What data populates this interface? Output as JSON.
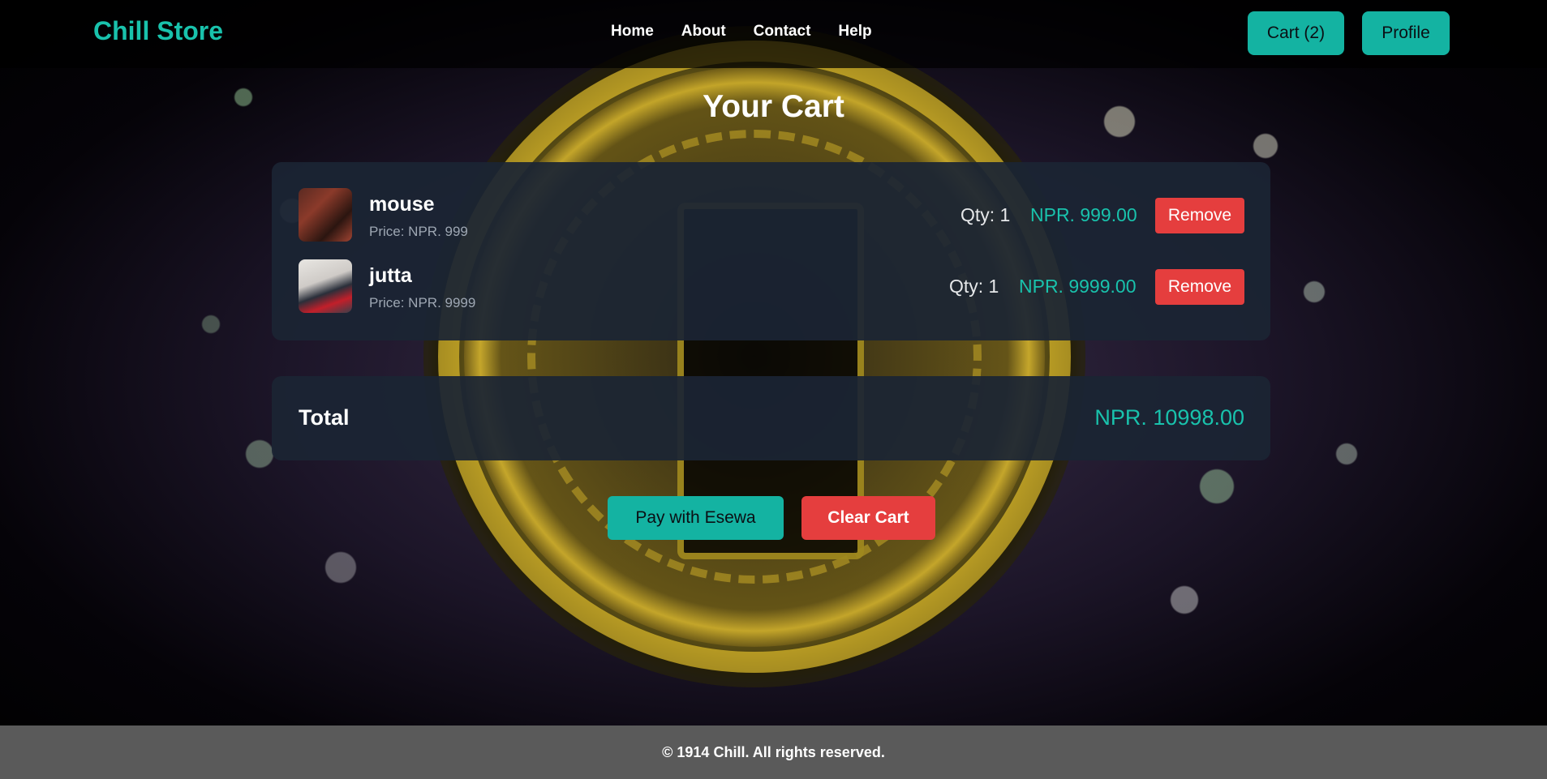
{
  "brand": "Chill Store",
  "nav": {
    "links": [
      "Home",
      "About",
      "Contact",
      "Help"
    ],
    "cart_label": "Cart (2)",
    "profile_label": "Profile"
  },
  "main": {
    "title": "Your Cart",
    "items": [
      {
        "name": "mouse",
        "price_label": "Price: NPR. 999",
        "qty_label": "Qty: 1",
        "line_total": "NPR. 999.00",
        "remove_label": "Remove"
      },
      {
        "name": "jutta",
        "price_label": "Price: NPR. 9999",
        "qty_label": "Qty: 1",
        "line_total": "NPR. 9999.00",
        "remove_label": "Remove"
      }
    ],
    "total_label": "Total",
    "total_value": "NPR. 10998.00",
    "pay_label": "Pay with Esewa",
    "clear_label": "Clear Cart"
  },
  "footer": {
    "text": "© 1914 Chill. All rights reserved."
  },
  "colors": {
    "accent": "#14b3a2",
    "brand_text": "#19c2ac",
    "danger": "#e53e3e",
    "panel": "#1b2534",
    "footer": "#5a5a5a"
  }
}
